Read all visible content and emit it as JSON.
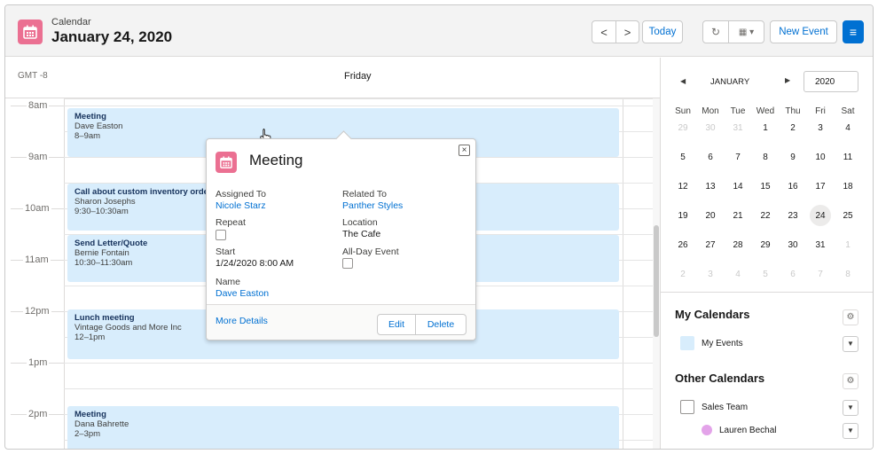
{
  "header": {
    "subtitle": "Calendar",
    "title": "January 24, 2020",
    "prev_icon": "<",
    "next_icon": ">",
    "today_label": "Today",
    "refresh_icon": "↻",
    "calendar_view_icon": "▦ ▾",
    "new_event_label": "New Event",
    "menu_icon": "≡"
  },
  "day_view": {
    "timezone": "GMT -8",
    "day_name": "Friday",
    "hours": [
      "8am",
      "9am",
      "10am",
      "11am",
      "12pm",
      "1pm",
      "2pm"
    ],
    "events": [
      {
        "title": "Meeting",
        "who": "Dave Easton",
        "time": "8–9am"
      },
      {
        "title": "Call about custom inventory orde",
        "who": "Sharon Josephs",
        "time": "9:30–10:30am"
      },
      {
        "title": "Send Letter/Quote",
        "who": "Bernie Fontain",
        "time": "10:30–11:30am"
      },
      {
        "title": "Lunch meeting",
        "who": "Vintage Goods and More Inc",
        "time": "12–1pm"
      },
      {
        "title": "Meeting",
        "who": "Dana Bahrette",
        "time": "2–3pm"
      }
    ]
  },
  "popover": {
    "title": "Meeting",
    "close_icon": "×",
    "assigned_to_label": "Assigned To",
    "assigned_to_value": "Nicole Starz",
    "related_to_label": "Related To",
    "related_to_value": "Panther Styles",
    "repeat_label": "Repeat",
    "location_label": "Location",
    "location_value": "The Cafe",
    "start_label": "Start",
    "start_value": "1/24/2020 8:00 AM",
    "all_day_label": "All-Day Event",
    "name_label": "Name",
    "name_value": "Dave Easton",
    "more_details": "More Details",
    "edit_label": "Edit",
    "delete_label": "Delete"
  },
  "mini_calendar": {
    "prev_icon": "◀",
    "month": "JANUARY",
    "next_icon": "▶",
    "year": "2020",
    "weekdays": [
      "Sun",
      "Mon",
      "Tue",
      "Wed",
      "Thu",
      "Fri",
      "Sat"
    ],
    "weeks": [
      [
        "29",
        "30",
        "31",
        "1",
        "2",
        "3",
        "4"
      ],
      [
        "5",
        "6",
        "7",
        "8",
        "9",
        "10",
        "11"
      ],
      [
        "12",
        "13",
        "14",
        "15",
        "16",
        "17",
        "18"
      ],
      [
        "19",
        "20",
        "21",
        "22",
        "23",
        "24",
        "25"
      ],
      [
        "26",
        "27",
        "28",
        "29",
        "30",
        "31",
        "1"
      ],
      [
        "2",
        "3",
        "4",
        "5",
        "6",
        "7",
        "8"
      ]
    ],
    "selected_day": "24"
  },
  "calendars": {
    "my_title": "My Calendars",
    "my_items": [
      {
        "label": "My Events",
        "color": "#d8edfc"
      }
    ],
    "other_title": "Other Calendars",
    "other_items": [
      {
        "label": "Sales Team",
        "color": "#ffffff"
      },
      {
        "label": "Lauren Bechal",
        "color": "#e3a3e9"
      }
    ],
    "gear_icon": "⚙",
    "caret_icon": "▼"
  },
  "colors": {
    "accent": "#0070d2",
    "event_bg": "#d8edfc",
    "app_icon": "#eb7092"
  }
}
